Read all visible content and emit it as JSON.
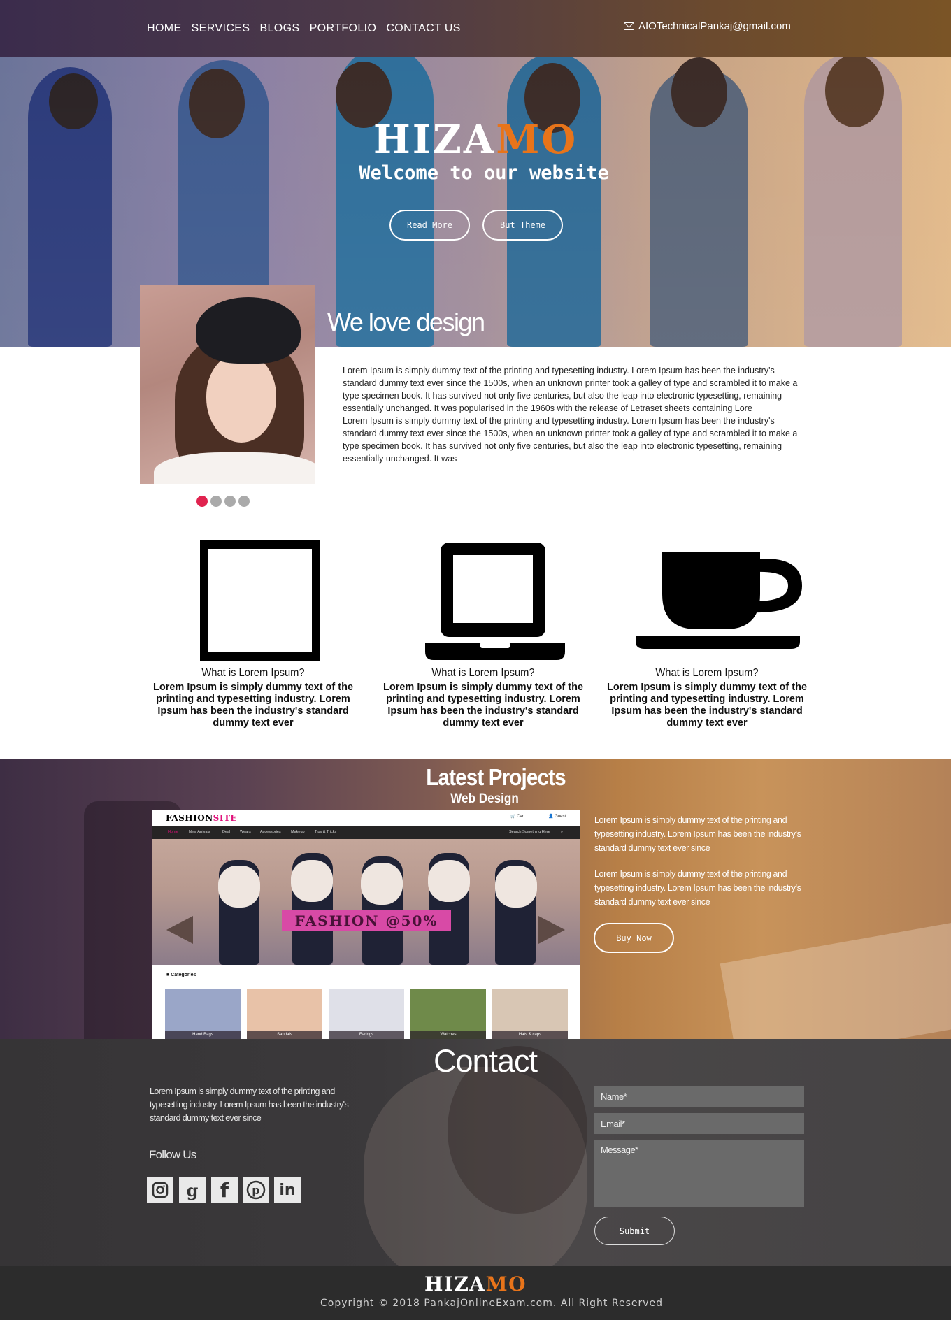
{
  "nav": {
    "items": [
      "HOME",
      "SERVICES",
      "BLOGS",
      "PORTFOLIO",
      "CONTACT US"
    ],
    "email": "AIOTechnicalPankaj@gmail.com",
    "email_icon": "envelope-icon"
  },
  "hero": {
    "brand_part1": "HIZA",
    "brand_part2": "MO",
    "tagline": "Welcome to our website",
    "read_more": "Read More",
    "buy_theme": "But Theme"
  },
  "about": {
    "title": "We love design",
    "paragraph1": "Lorem Ipsum is simply dummy text of the printing and typesetting industry. Lorem Ipsum has been the industry's standard dummy text ever since the 1500s, when an unknown printer took a galley of type and scrambled it to make a type specimen book. It has survived not only five centuries, but also the leap into electronic typesetting, remaining essentially unchanged. It was popularised in the 1960s with the release of Letraset sheets containing Lore",
    "paragraph2": "Lorem Ipsum is simply dummy text of the printing and typesetting industry. Lorem Ipsum has been the industry's standard dummy text ever since the 1500s, when an unknown printer took a galley of type and scrambled it to make a type specimen book. It has survived not only five centuries, but also the leap into electronic typesetting, remaining essentially unchanged. It was",
    "slider_dots": 4,
    "active_dot": 0
  },
  "features": [
    {
      "icon": "square-icon",
      "title": "What is Lorem Ipsum?",
      "text": "Lorem Ipsum is simply dummy text of the printing and typesetting industry. Lorem Ipsum has been the industry's standard dummy text ever"
    },
    {
      "icon": "laptop-icon",
      "title": "What is Lorem Ipsum?",
      "text": "Lorem Ipsum is simply dummy text of the printing and typesetting industry. Lorem Ipsum has been the industry's standard dummy text ever"
    },
    {
      "icon": "coffee-cup-icon",
      "title": "What is Lorem Ipsum?",
      "text": "Lorem Ipsum is simply dummy text of the printing and typesetting industry. Lorem Ipsum has been the industry's standard dummy text ever"
    }
  ],
  "projects": {
    "title": "Latest Projects",
    "subtitle": "Web Design",
    "text1": "Lorem Ipsum is simply dummy text of the printing and typesetting industry. Lorem Ipsum has been the industry's standard dummy text ever since",
    "text2": "Lorem Ipsum is simply dummy text of the printing and typesetting industry. Lorem Ipsum has been the industry's standard dummy text ever since",
    "buy_now": "Buy Now",
    "mock": {
      "logo_part1": "FASHION",
      "logo_part2": "SITE",
      "cart": "Cart",
      "guest": "Guest",
      "nav": [
        "Home",
        "New Arrivals",
        "Deal",
        "Wears",
        "Accessories",
        "Makeup",
        "Tips & Tricks"
      ],
      "search": "Search Something Here",
      "banner": "FASHION @50%",
      "categories_title": "Categories",
      "categories": [
        "Hand Bags",
        "Sandals",
        "Earings",
        "Watches",
        "Hats & caps"
      ]
    }
  },
  "contact": {
    "title": "Contact",
    "text": "Lorem Ipsum is simply dummy text of the printing and typesetting industry. Lorem Ipsum has been the industry's standard dummy text ever since",
    "follow": "Follow Us",
    "social": [
      "instagram-icon",
      "google-plus-icon",
      "facebook-icon",
      "pinterest-icon",
      "linkedin-icon"
    ],
    "name_placeholder": "Name*",
    "email_placeholder": "Email*",
    "message_placeholder": "Message*",
    "submit": "Submit"
  },
  "footer": {
    "brand_part1": "HIZA",
    "brand_part2": "MO",
    "copyright": "Copyright © 2018 PankajOnlineExam.com. All Right Reserved"
  },
  "colors": {
    "accent_orange": "#e8741a",
    "dot_active": "#e0234f",
    "mock_pink": "#e0107a"
  }
}
